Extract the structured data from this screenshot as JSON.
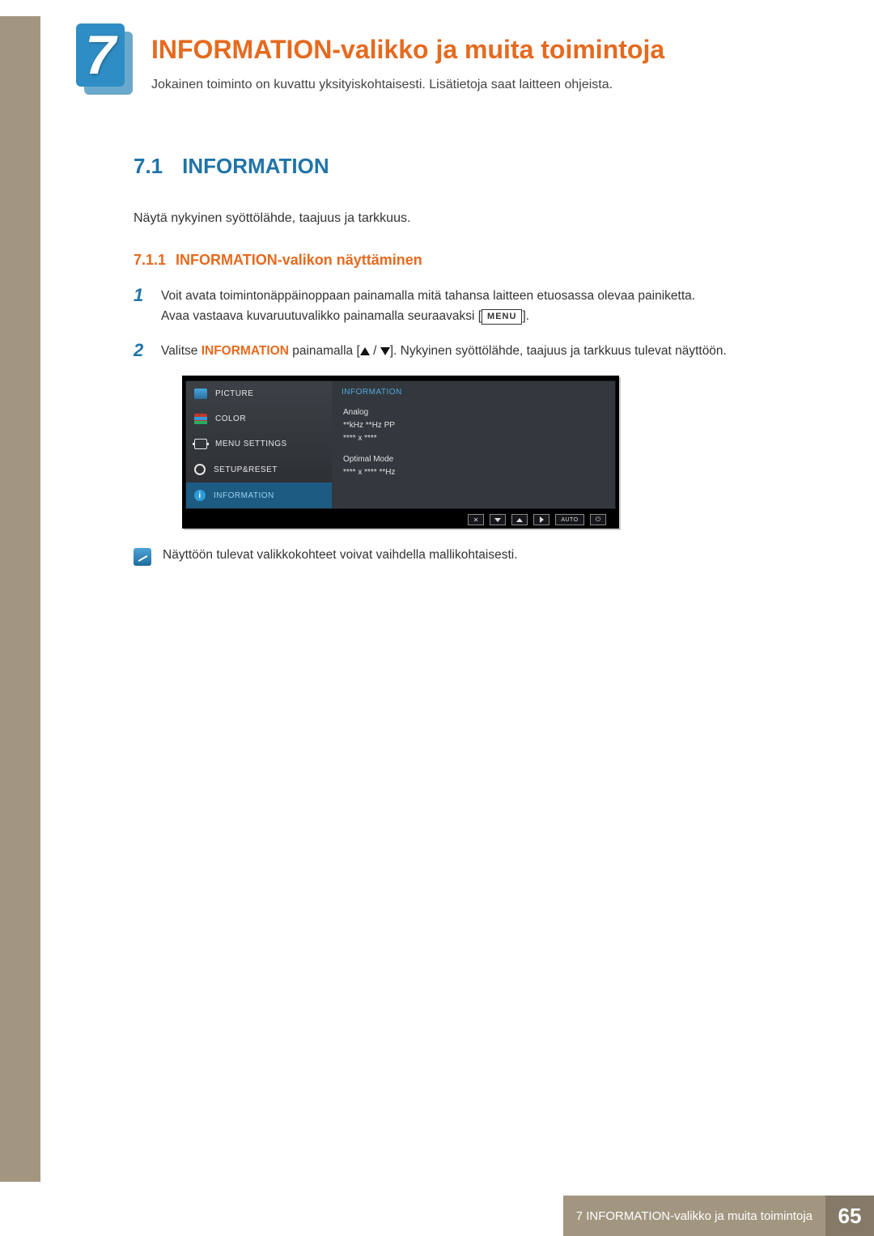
{
  "chapter": {
    "number": "7",
    "title": "INFORMATION-valikko ja muita toimintoja",
    "subtitle": "Jokainen toiminto on kuvattu yksityiskohtaisesti. Lisätietoja saat laitteen ohjeista."
  },
  "section": {
    "number": "7.1",
    "title": "INFORMATION",
    "intro": "Näytä nykyinen syöttölähde, taajuus ja tarkkuus."
  },
  "subsection": {
    "number": "7.1.1",
    "title": "INFORMATION-valikon näyttäminen"
  },
  "steps": {
    "1": {
      "line1": "Voit avata toimintonäppäinoppaan painamalla mitä tahansa laitteen etuosassa olevaa painiketta.",
      "line2a": "Avaa vastaava kuvaruutuvalikko painamalla seuraavaksi [",
      "menu_label": "MENU",
      "line2b": "]."
    },
    "2": {
      "a": "Valitse ",
      "highlight": "INFORMATION",
      "b": " painamalla [",
      "c": "]. Nykyinen syöttölähde, taajuus ja tarkkuus tulevat näyttöön."
    }
  },
  "osd": {
    "menu": {
      "picture": "PICTURE",
      "color": "COLOR",
      "menu_settings": "MENU SETTINGS",
      "setup_reset": "SETUP&RESET",
      "information": "INFORMATION"
    },
    "panel_title": "INFORMATION",
    "panel": {
      "l1": "Analog",
      "l2": "**kHz **Hz PP",
      "l3": "**** x ****",
      "l4": "Optimal Mode",
      "l5": "**** x **** **Hz"
    },
    "footer": {
      "auto": "AUTO"
    }
  },
  "note": "Näyttöön tulevat valikkokohteet voivat vaihdella mallikohtaisesti.",
  "footer": {
    "text": "7 INFORMATION-valikko ja muita toimintoja",
    "page": "65"
  }
}
